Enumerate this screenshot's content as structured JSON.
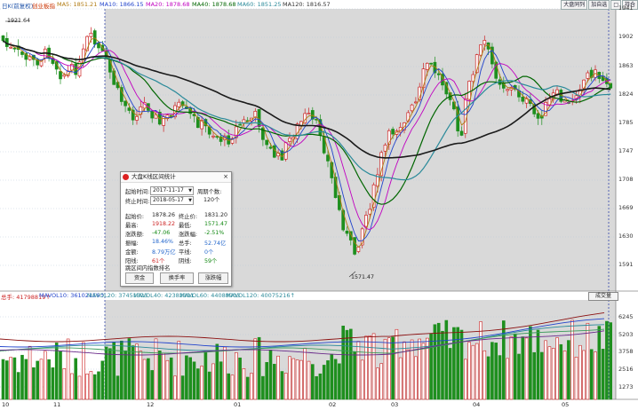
{
  "top_bar": {
    "items": [
      {
        "text": "日K(前复权)",
        "color": "#2255aa"
      },
      {
        "text": "创业板指",
        "color": "#cc3300"
      },
      {
        "text": "MA5: 1851.21",
        "color": "#b07a10"
      },
      {
        "text": "MA10: 1866.15",
        "color": "#2244cc"
      },
      {
        "text": "MA20: 1878.68",
        "color": "#c000c0"
      },
      {
        "text": "MA40: 1878.68",
        "color": "#006600"
      },
      {
        "text": "MA60: 1851.25",
        "color": "#2a8a9a"
      },
      {
        "text": "MA120: 1816.57",
        "color": "#333333"
      }
    ],
    "buttons": [
      "大盘同列",
      "加自选",
      "□",
      "持仓"
    ]
  },
  "price_axis": [
    "1941",
    "1902",
    "1863",
    "1824",
    "1785",
    "1747",
    "1708",
    "1669",
    "1630",
    "1591"
  ],
  "price_annotations": {
    "high": "1921.64",
    "low": "1571.47"
  },
  "volume_header": [
    {
      "text": "总手: 41798819↑",
      "color": "#cc2222"
    },
    {
      "text": "MAVOL10: 36102156↑",
      "color": "#2244cc"
    },
    {
      "text": "MAVOL20: 37451323",
      "color": "#2a8a9a"
    },
    {
      "text": "MAVOL40: 42382191",
      "color": "#2a8a9a"
    },
    {
      "text": "MAVOL60: 44088903",
      "color": "#2a8a9a"
    },
    {
      "text": "MAVOL120: 40075216↑",
      "color": "#2a8a9a"
    }
  ],
  "volume_axis": [
    "6245",
    "5203",
    "3758",
    "2516",
    "1273"
  ],
  "volume_unit_button": "成交量",
  "x_axis": [
    "10",
    "11",
    "12",
    "01",
    "02",
    "03",
    "04",
    "05"
  ],
  "dialog": {
    "title": "大盘K线区间统计",
    "close": "×",
    "start_label": "起始时间:",
    "start_value": "2017-11-17",
    "end_label": "终止时间:",
    "end_value": "2018-05-17",
    "period_label": "周期个数:",
    "period_value": "120个",
    "stats": [
      {
        "k": "起始价:",
        "v": "1878.26",
        "vc": "#222",
        "k2": "终止价:",
        "v2": "1831.20",
        "v2c": "#222"
      },
      {
        "k": "最高:",
        "v": "1918.22",
        "vc": "#cc2222",
        "k2": "最低:",
        "v2": "1571.47",
        "v2c": "#118811"
      },
      {
        "k": "涨跌额:",
        "v": "-47.06",
        "vc": "#118811",
        "k2": "涨跌幅:",
        "v2": "-2.51%",
        "v2c": "#118811"
      },
      {
        "k": "振幅:",
        "v": "18.46%",
        "vc": "#2266cc",
        "k2": "总手:",
        "v2": "52.74亿",
        "v2c": "#2266cc"
      },
      {
        "k": "金额:",
        "v": "8.79万亿",
        "vc": "#2266cc",
        "k2": "平线:",
        "v2": "0个",
        "v2c": "#2266cc"
      },
      {
        "k": "阳线:",
        "v": "61个",
        "vc": "#cc2222",
        "k2": "阴线:",
        "v2": "59个",
        "v2c": "#118811"
      }
    ],
    "section_label": "跳区间内指数排名",
    "buttons": [
      "资金",
      "换手率",
      "涨跌幅"
    ]
  },
  "colors": {
    "up": "#cc2222",
    "down": "#1e8f1e",
    "chart_bg": "#d9d9d9"
  }
}
